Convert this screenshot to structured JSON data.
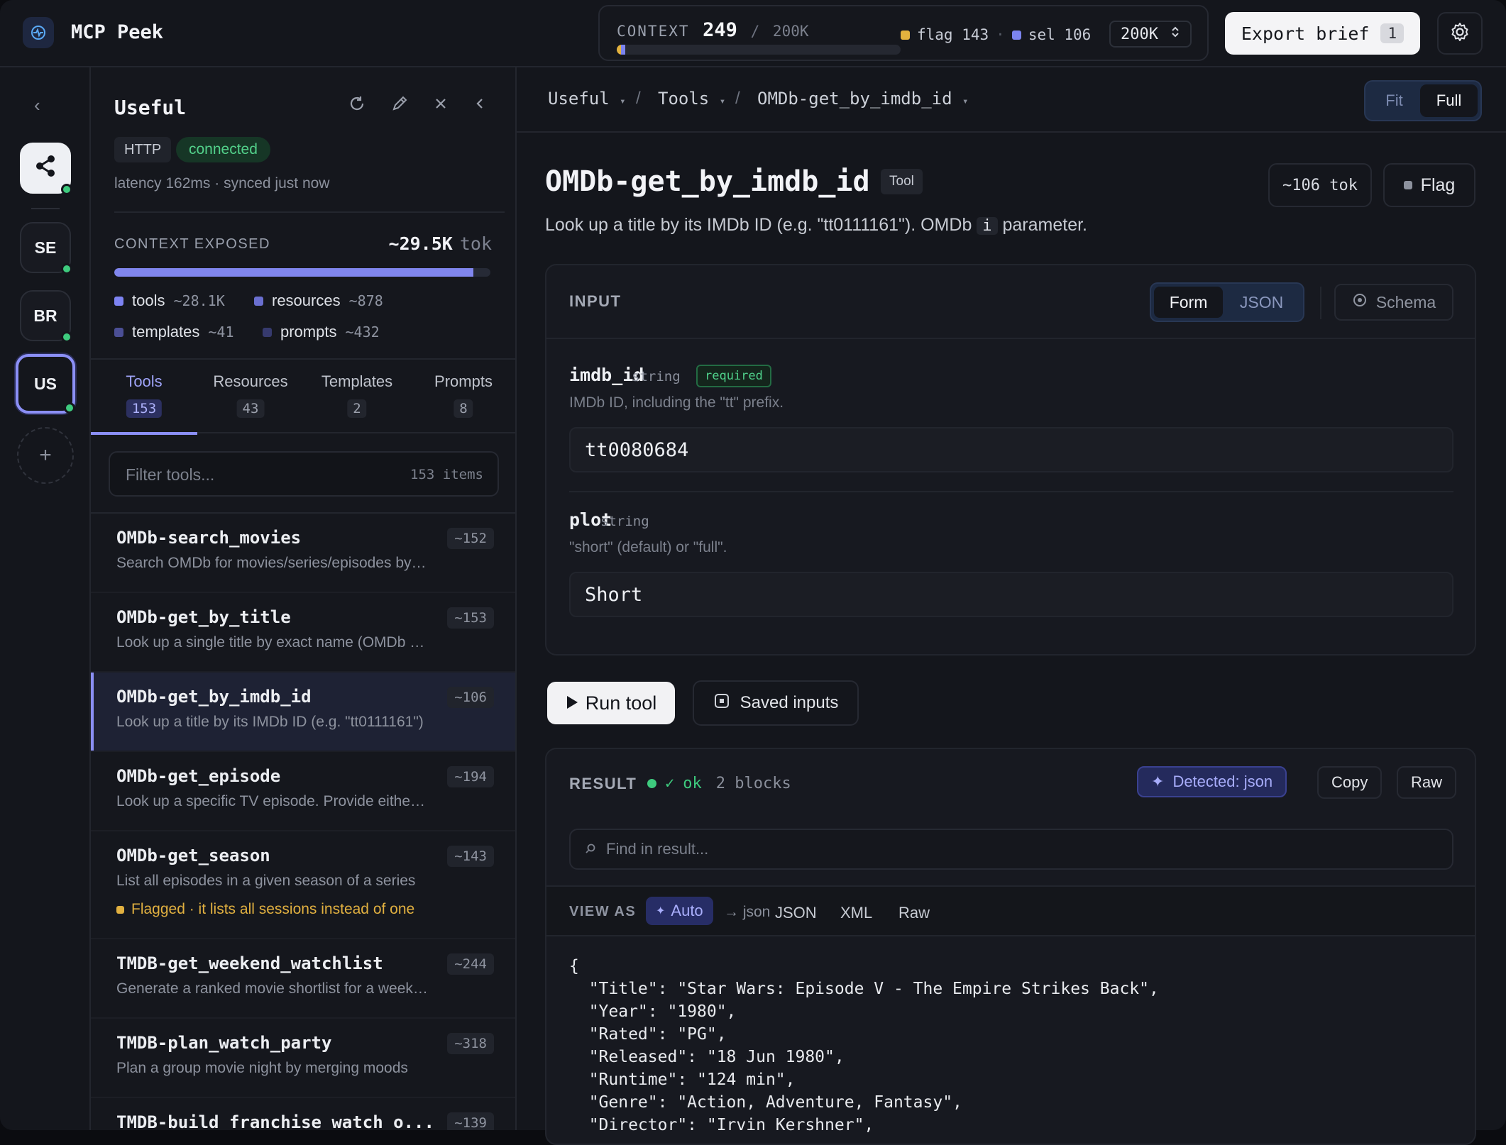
{
  "app": {
    "title": "MCP Peek"
  },
  "context": {
    "label": "CONTEXT",
    "value": "249",
    "sep": "/",
    "max": "200K",
    "flag_text": "flag 143",
    "dot_sep": "·",
    "sel_text": "sel 106",
    "select_value": "200K",
    "flag_fraction": 0.006,
    "sel_fraction": 0.012,
    "flag_color": "#e2b23e",
    "sel_color": "#7c84ef"
  },
  "toolbar": {
    "export_label": "Export brief",
    "export_count": "1",
    "settings_icon": "gear-icon"
  },
  "rail": {
    "collapse": "‹",
    "servers": [
      {
        "label": "",
        "icon": "share-icon"
      },
      {
        "label": "SE"
      },
      {
        "label": "BR"
      },
      {
        "label": "US"
      }
    ],
    "add": "+"
  },
  "server": {
    "name": "Useful",
    "transport": "HTTP",
    "status": "connected",
    "latency": "latency 162ms · synced just now",
    "context_label": "CONTEXT EXPOSED",
    "context_value": "~29.5K",
    "context_unit": "tok",
    "context_fill_fraction": 0.955,
    "legend": [
      {
        "label": "tools",
        "value": "~28.1K",
        "color": "#7d83f2"
      },
      {
        "label": "resources",
        "value": "~878",
        "color": "#6a6fd0"
      },
      {
        "label": "templates",
        "value": "~41",
        "color": "#4b4f95"
      },
      {
        "label": "prompts",
        "value": "~432",
        "color": "#363a6e"
      }
    ]
  },
  "tabs": [
    {
      "label": "Tools",
      "count": "153"
    },
    {
      "label": "Resources",
      "count": "43"
    },
    {
      "label": "Templates",
      "count": "2"
    },
    {
      "label": "Prompts",
      "count": "8"
    }
  ],
  "filter": {
    "placeholder": "Filter tools...",
    "count": "153 items"
  },
  "tools": [
    {
      "name": "OMDb-search_movies",
      "desc": "Search OMDb for movies/series/episodes by title",
      "tok": "~152"
    },
    {
      "name": "OMDb-get_by_title",
      "desc": "Look up a single title by exact name (OMDb t parameter)",
      "tok": "~153"
    },
    {
      "name": "OMDb-get_by_imdb_id",
      "desc": "Look up a title by its IMDb ID (e.g. \"tt0111161\")",
      "tok": "~106"
    },
    {
      "name": "OMDb-get_episode",
      "desc": "Look up a specific TV episode. Provide either the series",
      "tok": "~194"
    },
    {
      "name": "OMDb-get_season",
      "desc": "List all episodes in a given season of a series",
      "tok": "~143",
      "flag": "Flagged · it lists all sessions instead of one"
    },
    {
      "name": "TMDB-get_weekend_watchlist",
      "desc": "Generate a ranked movie shortlist for a weekend",
      "tok": "~244"
    },
    {
      "name": "TMDB-plan_watch_party",
      "desc": "Plan a group movie night by merging moods",
      "tok": "~318"
    },
    {
      "name": "TMDB-build_franchise_watch_o...",
      "desc": "",
      "tok": "~139"
    }
  ],
  "breadcrumb": [
    {
      "label": "Useful",
      "caret": "▾"
    },
    {
      "label": "Tools",
      "caret": "▾"
    },
    {
      "label": "OMDb-get_by_imdb_id",
      "caret": "▾"
    }
  ],
  "view_toggle": {
    "fit": "Fit",
    "full": "Full"
  },
  "tool": {
    "title": "OMDb-get_by_imdb_id",
    "badge": "Tool",
    "tokens": "~106 tok",
    "flag_label": "Flag",
    "desc_before": "Look up a title by its IMDb ID (e.g. \"tt0111161\"). OMDb",
    "desc_code": "i",
    "desc_after": "parameter."
  },
  "input": {
    "label": "INPUT",
    "mode_form": "Form",
    "mode_json": "JSON",
    "schema": "Schema",
    "fields": [
      {
        "name": "imdb_id",
        "type": "string",
        "required": "required",
        "help": "IMDb ID, including the \"tt\" prefix.",
        "value": "tt0080684"
      },
      {
        "name": "plot",
        "type": "string",
        "help": "\"short\" (default) or \"full\".",
        "value": "Short"
      }
    ]
  },
  "actions": {
    "run": "Run tool",
    "saved": "Saved inputs"
  },
  "result": {
    "label": "RESULT",
    "status": "ok",
    "blocks": "2 blocks",
    "detected": "Detected: json",
    "copy": "Copy",
    "raw": "Raw",
    "find_placeholder": "Find in result...",
    "view_as_label": "VIEW AS",
    "view_auto": "Auto",
    "view_detected": "→ json",
    "view_json": "JSON",
    "view_xml": "XML",
    "view_raw": "Raw",
    "lines": [
      "{",
      "  \"Title\": \"Star Wars: Episode V - The Empire Strikes Back\",",
      "  \"Year\": \"1980\",",
      "  \"Rated\": \"PG\",",
      "  \"Released\": \"18 Jun 1980\",",
      "  \"Runtime\": \"124 min\",",
      "  \"Genre\": \"Action, Adventure, Fantasy\",",
      "  \"Director\": \"Irvin Kershner\","
    ]
  }
}
